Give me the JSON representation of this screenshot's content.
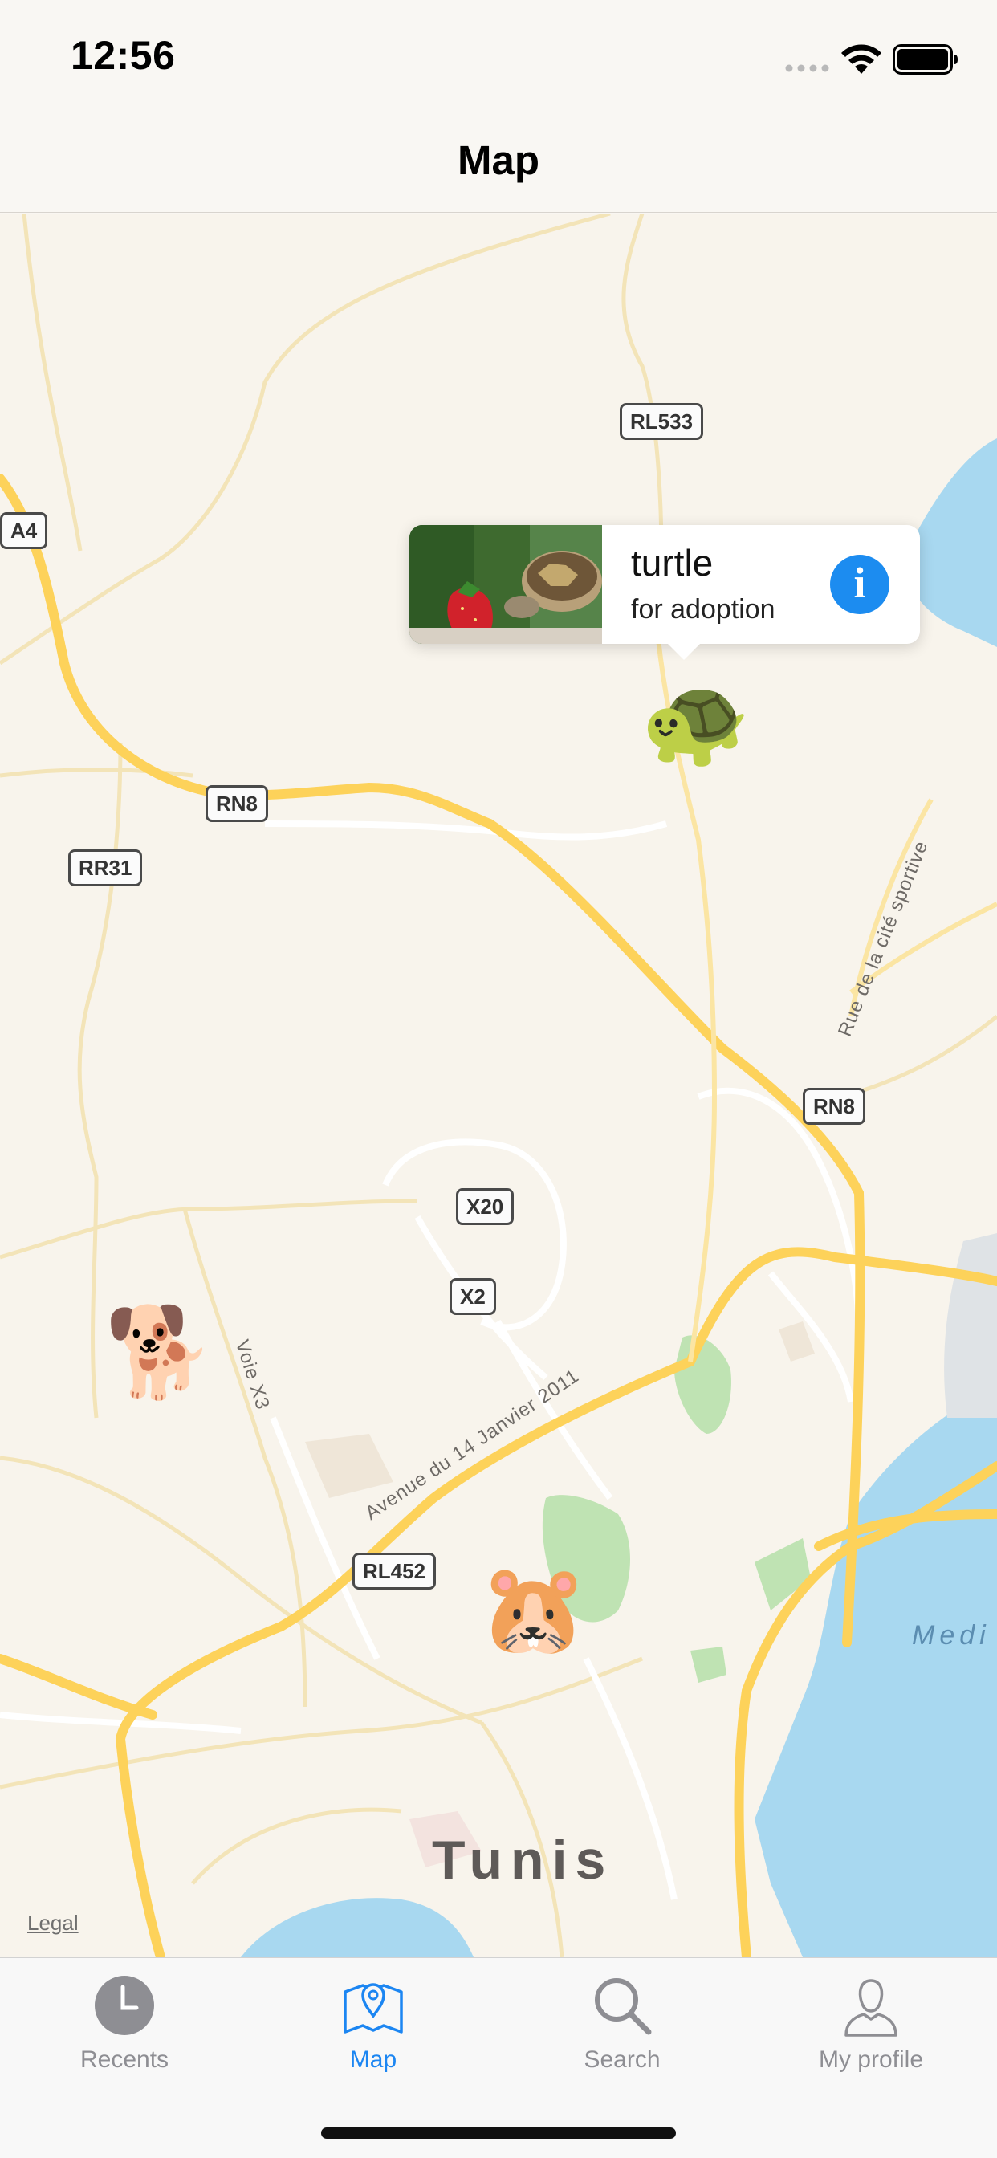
{
  "status_bar": {
    "time": "12:56",
    "icons": [
      "cellular-signal-icon",
      "wifi-icon",
      "battery-icon"
    ]
  },
  "nav": {
    "title": "Map"
  },
  "map": {
    "road_badges": [
      "RL533",
      "A4",
      "RN8",
      "RR31",
      "RN8",
      "X20",
      "X2",
      "RL452"
    ],
    "street_labels": [
      "Rue de la cité sportive",
      "Voie X3",
      "Avenue du 14 Janvier 2011"
    ],
    "city_label": "Tunis",
    "sea_label": "Medi",
    "legal": "Legal",
    "pins": [
      {
        "animal": "turtle",
        "glyph": "🐢"
      },
      {
        "animal": "dog",
        "glyph": "🐕"
      },
      {
        "animal": "hamster",
        "glyph": "🐹"
      }
    ],
    "callout": {
      "title": "turtle",
      "subtitle": "for adoption",
      "info_glyph": "i"
    }
  },
  "tab_bar": {
    "items": [
      {
        "label": "Recents",
        "icon": "clock-icon",
        "active": false
      },
      {
        "label": "Map",
        "icon": "map-pin-icon",
        "active": true
      },
      {
        "label": "Search",
        "icon": "magnifier-icon",
        "active": false
      },
      {
        "label": "My profile",
        "icon": "person-icon",
        "active": false
      }
    ]
  },
  "colors": {
    "accent": "#1c86f2",
    "map_background": "#f8f4ec",
    "major_road": "#fdd25a",
    "water": "#a8d8f0",
    "park": "#bfe3b3"
  }
}
